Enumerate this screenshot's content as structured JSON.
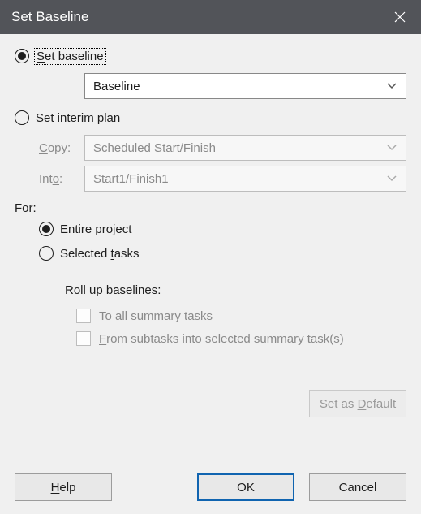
{
  "title": "Set Baseline",
  "options": {
    "set_baseline": {
      "label_prefix": "S",
      "label_rest": "et baseline"
    },
    "set_interim": {
      "label_rest": "Set interim plan"
    }
  },
  "baseline_select": {
    "value": "Baseline"
  },
  "interim": {
    "copy_label_u": "C",
    "copy_label_rest": "opy:",
    "copy_value": "Scheduled Start/Finish",
    "into_label_u_pos": "Int",
    "into_label_u": "o",
    "into_label_rest2": ":",
    "into_value": "Start1/Finish1"
  },
  "for": {
    "label": "For:",
    "entire_u": "E",
    "entire_rest": "ntire project",
    "selected_pre": "Selected ",
    "selected_u": "t",
    "selected_post": "asks"
  },
  "rollup": {
    "title": "Roll up baselines:",
    "opt1_pre": "To ",
    "opt1_u": "a",
    "opt1_post": "ll summary tasks",
    "opt2_u": "F",
    "opt2_post": "rom subtasks into selected summary task(s)"
  },
  "buttons": {
    "default_pre": "Set as ",
    "default_u": "D",
    "default_post": "efault",
    "help_u": "H",
    "help_post": "elp",
    "ok": "OK",
    "cancel": "Cancel"
  }
}
